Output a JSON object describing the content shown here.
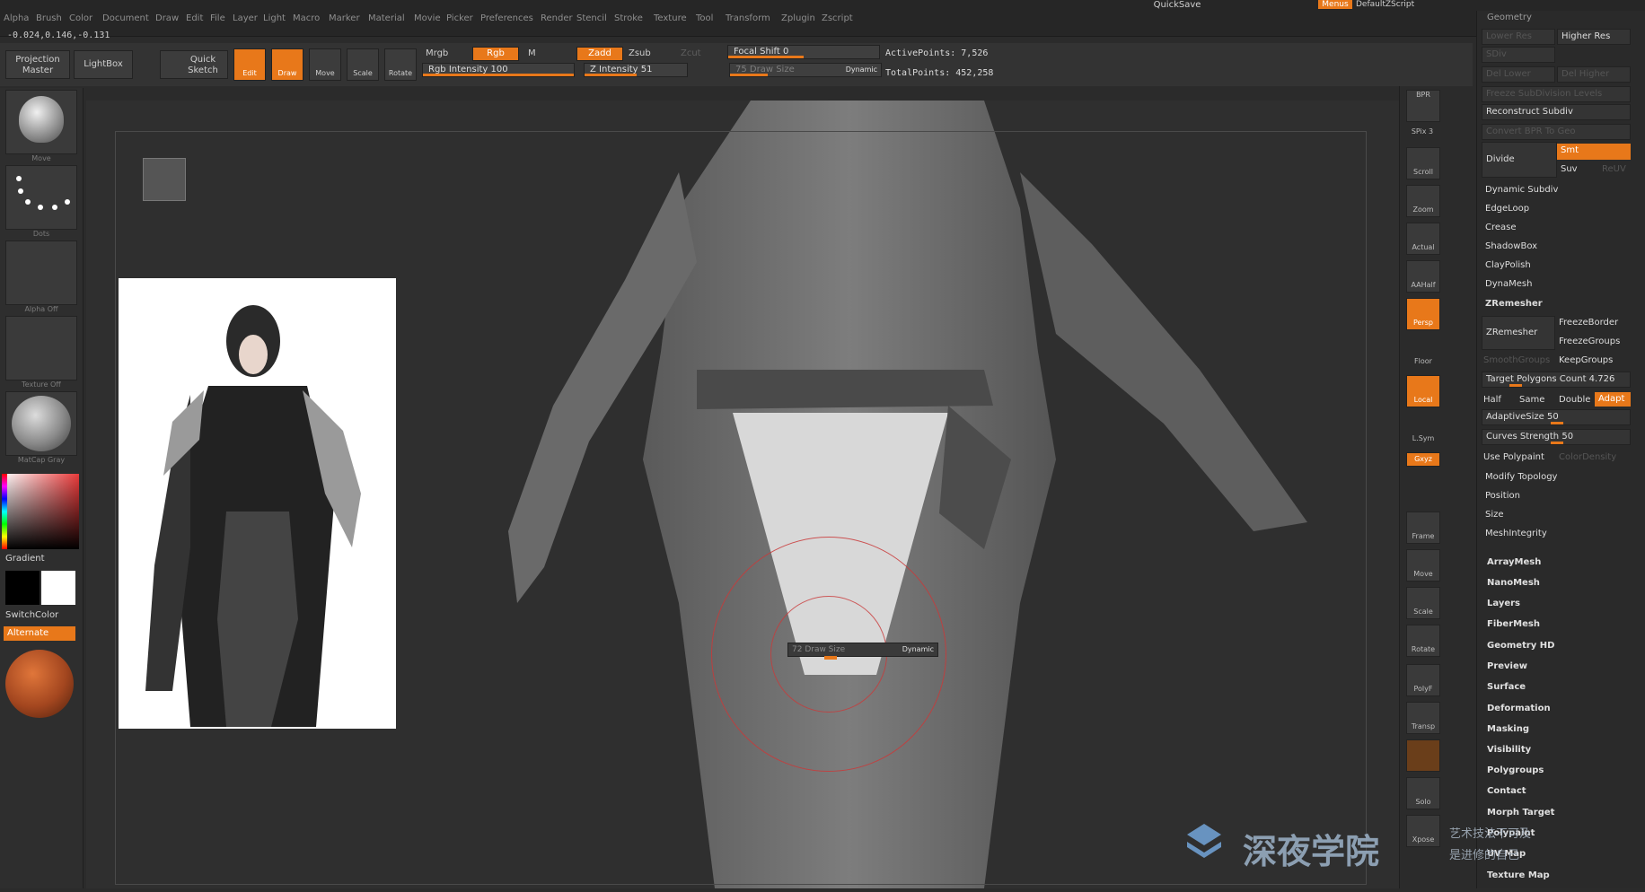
{
  "menubar": {
    "items": [
      "Alpha",
      "Brush",
      "Color",
      "Document",
      "Draw",
      "Edit",
      "File",
      "Layer",
      "Light",
      "Macro",
      "Marker",
      "Material",
      "Movie",
      "Picker",
      "Preferences",
      "Render",
      "Stencil",
      "Stroke",
      "Texture",
      "Tool",
      "Transform",
      "Zplugin",
      "Zscript"
    ],
    "quicksave": "QuickSave",
    "menus": "Menus",
    "default_script": "DefaultZScript"
  },
  "coords": "-0.024,0.146,-0.131",
  "toolbar": {
    "projection_master": "Projection Master",
    "lightbox": "LightBox",
    "quick_sketch": "Quick Sketch",
    "edit": "Edit",
    "draw": "Draw",
    "move": "Move",
    "scale": "Scale",
    "rotate": "Rotate",
    "mrgb": "Mrgb",
    "rgb": "Rgb",
    "m": "M",
    "rgb_intensity": "Rgb Intensity 100",
    "zadd": "Zadd",
    "zsub": "Zsub",
    "zcut": "Zcut",
    "z_intensity": "Z Intensity 51",
    "focal_shift": "Focal Shift 0",
    "draw_size": "75 Draw Size",
    "dynamic": "Dynamic",
    "active_points": "ActivePoints: 7,526",
    "total_points": "TotalPoints: 452,258"
  },
  "left": {
    "mesh_label": "Move",
    "dots_label": "Dots",
    "alpha_label": "Alpha Off",
    "texture_label": "Texture Off",
    "matcap_label": "MatCap Gray",
    "gradient": "Gradient",
    "switchcolor": "SwitchColor",
    "alternate": "Alternate"
  },
  "dock": {
    "bpr": "BPR",
    "spix": "SPix 3",
    "scroll": "Scroll",
    "zoom": "Zoom",
    "actual": "Actual",
    "aahalf": "AAHalf",
    "persp": "Persp",
    "floor": "Floor",
    "local": "Local",
    "lsym": "L.Sym",
    "xyz": "Gxyz",
    "frame": "Frame",
    "move": "Move",
    "scale": "Scale",
    "rotate": "Rotate",
    "polyf": "PolyF",
    "transp": "Transp",
    "solo": "Solo",
    "xpose": "Xpose"
  },
  "panel": {
    "title": "Geometry",
    "lower_res": "Lower Res",
    "higher_res": "Higher Res",
    "sdiv": "SDiv",
    "del_lower": "Del Lower",
    "del_higher": "Del Higher",
    "freeze_subdiv": "Freeze SubDivision Levels",
    "reconstruct": "Reconstruct Subdiv",
    "convert_bpr": "Convert BPR To Geo",
    "divide": "Divide",
    "smt": "Smt",
    "suv": "Suv",
    "reuv": "ReUV",
    "dynamic_subdiv": "Dynamic Subdiv",
    "edgeloop": "EdgeLoop",
    "crease": "Crease",
    "shadowbox": "ShadowBox",
    "claypolish": "ClayPolish",
    "dynamesh": "DynaMesh",
    "zremesher_header": "ZRemesher",
    "zremesher_btn": "ZRemesher",
    "freeze_border": "FreezeBorder",
    "freeze_groups": "FreezeGroups",
    "smooth_groups": "SmoothGroups",
    "keep_groups": "KeepGroups",
    "target_poly": "Target Polygons Count 4.726",
    "half": "Half",
    "same": "Same",
    "double": "Double",
    "adapt": "Adapt",
    "adaptive_size": "AdaptiveSize 50",
    "curves_strength": "Curves Strength 50",
    "use_polypaint": "Use Polypaint",
    "color_density": "ColorDensity",
    "modify_topology": "Modify Topology",
    "position": "Position",
    "size": "Size",
    "mesh_integrity": "MeshIntegrity",
    "subpalettes": [
      "ArrayMesh",
      "NanoMesh",
      "Layers",
      "FiberMesh",
      "Geometry HD",
      "Preview",
      "Surface",
      "Deformation",
      "Masking",
      "Visibility",
      "Polygroups",
      "Contact",
      "Morph Target",
      "Polypaint",
      "UV Map",
      "Texture Map"
    ]
  },
  "brush_popup": {
    "label": "72 Draw Size",
    "dynamic": "Dynamic"
  },
  "watermark": {
    "logo_text": "深夜学院",
    "line1": "艺术技法不可及",
    "line2": "是进修的自己"
  },
  "colors": {
    "accent": "#e8781a"
  }
}
